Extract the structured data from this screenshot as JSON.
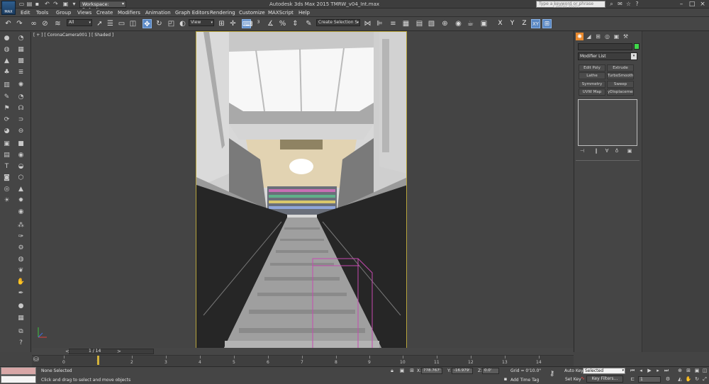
{
  "titlebar": {
    "logo_text": "MAX",
    "workspace": "Workspace: Default",
    "app_title": "Autodesk 3ds Max  2015     TMRW_v04_Int.max",
    "search_placeholder": "Type a keyword or phrase",
    "minimize": "–",
    "maximize": "□",
    "close": "×"
  },
  "menubar": {
    "items": [
      "Edit",
      "Tools",
      "Group",
      "Views",
      "Create",
      "Modifiers",
      "Animation",
      "Graph Editors",
      "Rendering",
      "Customize",
      "MAXScript",
      "Help"
    ]
  },
  "maintoolbar": {
    "selection_filter": "All",
    "ref_coord": "View",
    "named_selection": "Create Selection S",
    "axes": [
      "X",
      "Y",
      "Z",
      "XY"
    ],
    "center_pivot": "Center Pivot"
  },
  "viewport": {
    "label": "[ + ] [ CoronaCamera001 ] [ Shaded ]"
  },
  "rightpanel": {
    "modifier_list": "Modifier List",
    "modifier_buttons": [
      "Edit Poly",
      "Extrude",
      "Lathe",
      "TurboSmooth",
      "Symmetry",
      "Sweep",
      "UVW Map",
      "yDisplacement"
    ]
  },
  "timeline": {
    "frame_text": "1 / 14",
    "ticks": [
      "0",
      "1",
      "2",
      "3",
      "4",
      "5",
      "6",
      "7",
      "8",
      "9",
      "10",
      "11",
      "12",
      "13",
      "14"
    ]
  },
  "status": {
    "selection": "None Selected",
    "prompt": "Click and drag to select and move objects",
    "x_label": "X:",
    "x_value": "778.767'",
    "y_label": "Y:",
    "y_value": "-16.979'",
    "z_label": "Z:",
    "z_value": "0.0'",
    "grid": "Grid = 0'10.0\"",
    "add_time_tag": "Add Time Tag",
    "auto_key": "Auto Key",
    "set_key": "Set Key",
    "set_key_mode": "Selected",
    "key_filters": "Key Filters...",
    "current_frame": "1"
  }
}
